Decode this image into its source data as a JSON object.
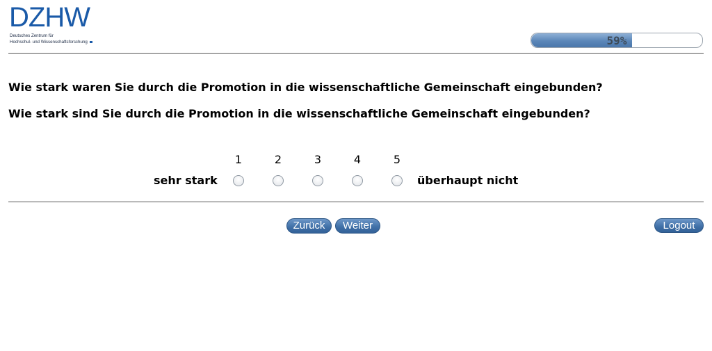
{
  "logo": {
    "word": "DZHW",
    "subtitle_line1": "Deutsches Zentrum für",
    "subtitle_line2": "Hochschul- und Wissenschaftsforschung"
  },
  "progress": {
    "value": 0.59,
    "label": "59%"
  },
  "questions": [
    "Wie stark waren Sie durch die Promotion in die wissenschaftliche Gemeinschaft eingebunden?",
    "Wie stark sind Sie durch die Promotion in die wissenschaftliche Gemeinschaft eingebunden?"
  ],
  "scale": {
    "numbers": [
      "1",
      "2",
      "3",
      "4",
      "5"
    ],
    "left_anchor": "sehr stark",
    "right_anchor": "überhaupt nicht",
    "selected": null
  },
  "nav": {
    "back": "Zurück",
    "next": "Weiter",
    "logout": "Logout"
  },
  "colors": {
    "brand": "#1a5aa8",
    "button": "#3f6fa6"
  }
}
